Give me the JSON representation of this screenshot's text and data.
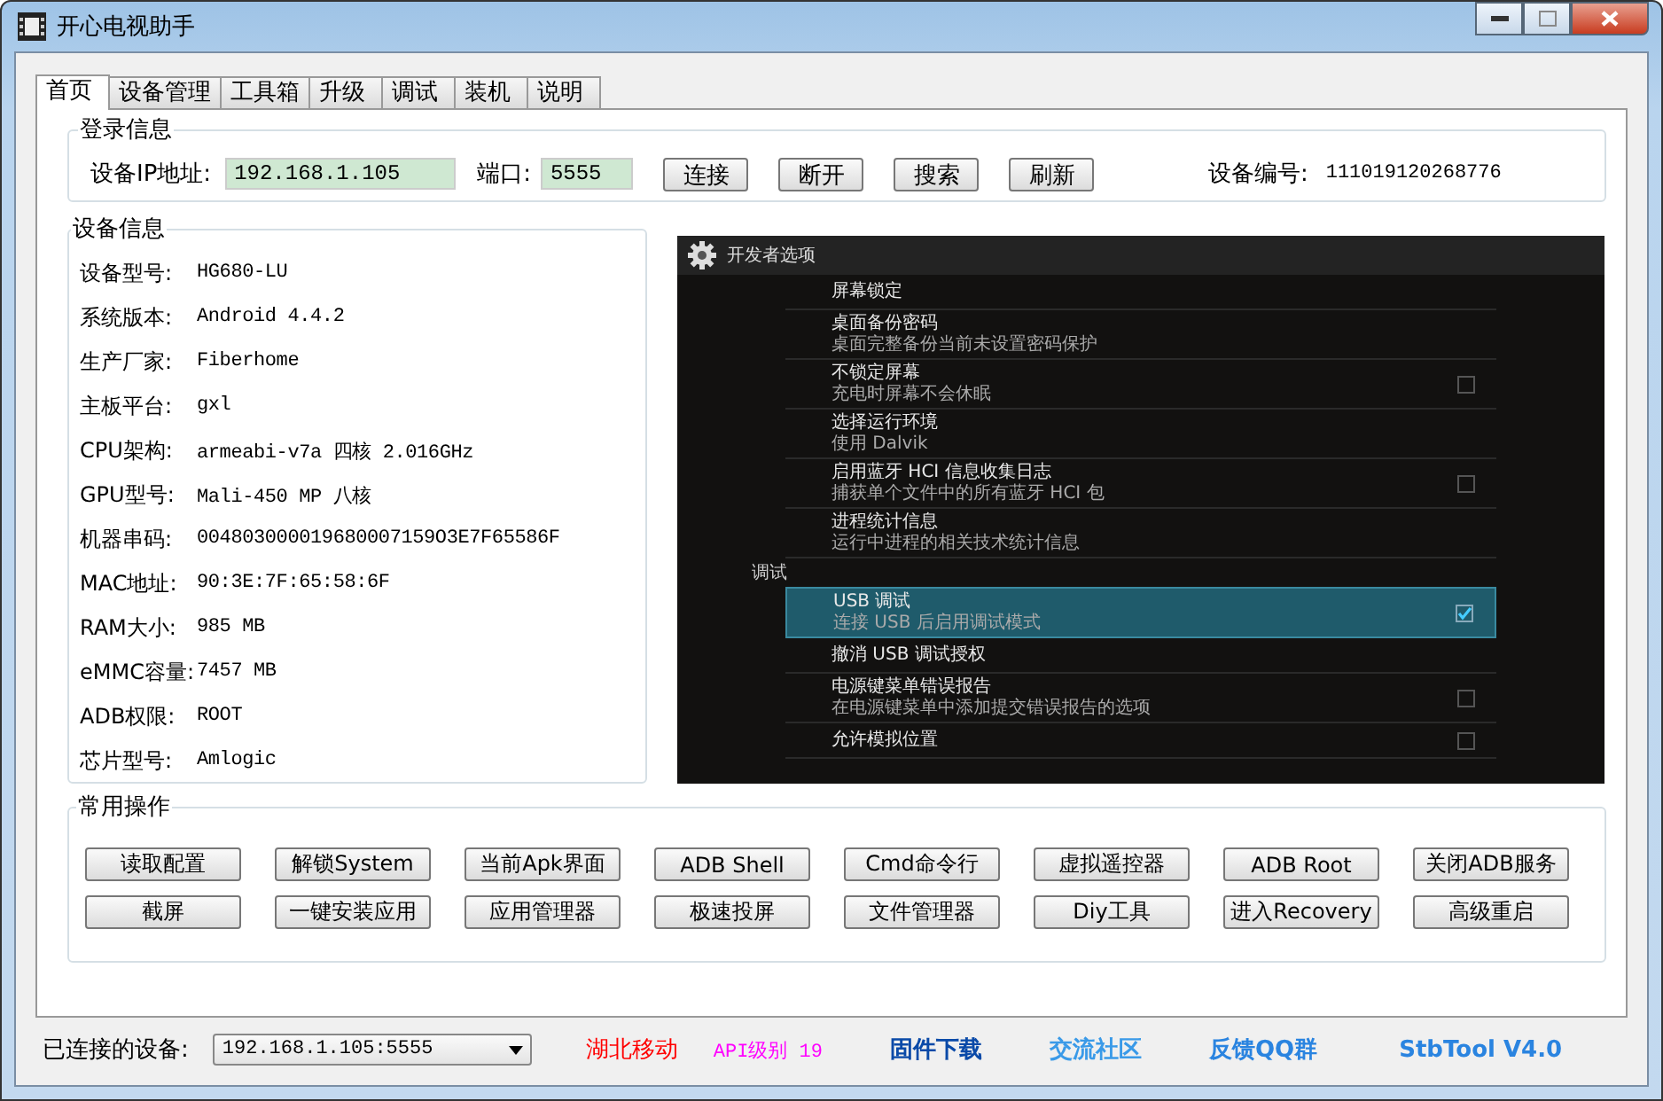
{
  "window": {
    "title": "开心电视助手"
  },
  "tabs": [
    {
      "label": "首页",
      "selected": true
    },
    {
      "label": "设备管理",
      "selected": false
    },
    {
      "label": "工具箱",
      "selected": false
    },
    {
      "label": "升级",
      "selected": false
    },
    {
      "label": "调试",
      "selected": false
    },
    {
      "label": "装机",
      "selected": false
    },
    {
      "label": "说明",
      "selected": false
    }
  ],
  "login": {
    "title": "登录信息",
    "ip_label": "设备IP地址:",
    "ip_value": "192.168.1.105",
    "port_label": "端口:",
    "port_value": "5555",
    "buttons": [
      "连接",
      "断开",
      "搜索",
      "刷新"
    ],
    "device_id_label": "设备编号:",
    "device_id": "111019120268776"
  },
  "device_info": {
    "title": "设备信息",
    "rows": [
      {
        "label": "设备型号:",
        "value": "HG680-LU"
      },
      {
        "label": "系统版本:",
        "value": "Android 4.4.2"
      },
      {
        "label": "生产厂家:",
        "value": "Fiberhome"
      },
      {
        "label": "主板平台:",
        "value": "gxl"
      },
      {
        "label": "CPU架构:",
        "value": "armeabi-v7a 四核 2.016GHz"
      },
      {
        "label": "GPU型号:",
        "value": "Mali-450 MP 八核"
      },
      {
        "label": "机器串码:",
        "value": "004803000019680007159O3E7F65586F"
      },
      {
        "label": "MAC地址:",
        "value": "90:3E:7F:65:58:6F"
      },
      {
        "label": "RAM大小:",
        "value": "985 MB"
      },
      {
        "label": "eMMC容量:",
        "value": "7457 MB"
      },
      {
        "label": "ADB权限:",
        "value": "ROOT"
      },
      {
        "label": "芯片型号:",
        "value": "Amlogic"
      }
    ]
  },
  "screen": {
    "title": "开发者选项",
    "items": [
      {
        "kind": "plain",
        "title": "屏幕锁定",
        "selected": false
      },
      {
        "kind": "plain",
        "title": "桌面备份密码",
        "subtitle": "桌面完整备份当前未设置密码保护",
        "selected": false
      },
      {
        "kind": "check",
        "title": "不锁定屏幕",
        "subtitle": "充电时屏幕不会休眠",
        "checked": false,
        "selected": false
      },
      {
        "kind": "plain",
        "title": "选择运行环境",
        "subtitle": "使用 Dalvik",
        "selected": false
      },
      {
        "kind": "check",
        "title": "启用蓝牙 HCI 信息收集日志",
        "subtitle": "捕获单个文件中的所有蓝牙 HCI 包",
        "checked": false,
        "selected": false
      },
      {
        "kind": "plain",
        "title": "进程统计信息",
        "subtitle": "运行中进程的相关技术统计信息",
        "selected": false
      },
      {
        "kind": "header",
        "title": "调试"
      },
      {
        "kind": "check",
        "title": "USB 调试",
        "subtitle": "连接 USB 后启用调试模式",
        "checked": true,
        "selected": true
      },
      {
        "kind": "plain",
        "title": "撤消 USB 调试授权",
        "selected": false
      },
      {
        "kind": "check",
        "title": "电源键菜单错误报告",
        "subtitle": "在电源键菜单中添加提交错误报告的选项",
        "checked": false,
        "selected": false
      },
      {
        "kind": "check",
        "title": "允许模拟位置",
        "checked": false,
        "selected": false
      }
    ]
  },
  "operations": {
    "title": "常用操作",
    "buttons": [
      "读取配置",
      "解锁System",
      "当前Apk界面",
      "ADB Shell",
      "Cmd命令行",
      "虚拟遥控器",
      "ADB  Root",
      "关闭ADB服务",
      "截屏",
      "一键安装应用",
      "应用管理器",
      "极速投屏",
      "文件管理器",
      "Diy工具",
      "进入Recovery",
      "高级重启"
    ]
  },
  "status_bar": {
    "connected_label": "已连接的设备:",
    "device": "192.168.1.105:5555",
    "carrier": "湖北移动",
    "api_level": "API级别 19",
    "links": [
      "固件下载",
      "交流社区",
      "反馈QQ群"
    ],
    "version": "StbTool V4.0"
  }
}
